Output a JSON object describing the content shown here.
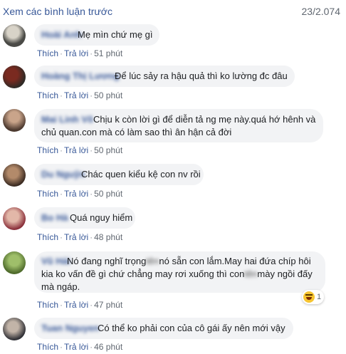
{
  "header": {
    "view_previous": "Xem các bình luận trước",
    "count": "23/2.074"
  },
  "labels": {
    "like": "Thích",
    "reply": "Trả lời"
  },
  "comments": [
    {
      "author": "Hoài Anh",
      "text": "Mẹ mìn chứ mẹ gì",
      "time": "51 phút"
    },
    {
      "author": "Hoàng Thị Lương",
      "text": "Để lúc sảy ra hậu quả thì ko lường đc đâu",
      "time": "50 phút"
    },
    {
      "author": "Mai Linh Võ",
      "text_line1": "Chịu k còn lời gì để diễn tả ng mẹ này.quá hớ hênh và",
      "text_line2": "chủ quan.con mà có làm sao thì ân hận cả đời",
      "time": "50 phút"
    },
    {
      "author": "Du Nguỹn",
      "text": "Chác quen kiểu kệ con nv rồi",
      "time": "50 phút"
    },
    {
      "author": "Bo Hà",
      "text": "Quá nguy hiểm",
      "time": "48 phút"
    },
    {
      "author": "Vũ Hải",
      "line1_a": "Nó đang nghĩ trọng",
      "line1_blur": "tên",
      "line1_b": "nó sẵn con lắm.May hai đứa chíp hôi",
      "line2_a": "kia ko vấn đề gì chứ chẳng may rơi xuống thì con",
      "line2_blur": "tên",
      "line2_b": "mày ngồi đấy",
      "line3": "mà ngáp.",
      "reaction_count": "1",
      "time": "47 phút"
    },
    {
      "author": "Tuan Nguyen",
      "text": "Có thể ko phải con của cô gái ấy nên mới vậy",
      "time": "46 phút"
    }
  ],
  "icons": {
    "reaction": "haha-reaction-icon"
  }
}
